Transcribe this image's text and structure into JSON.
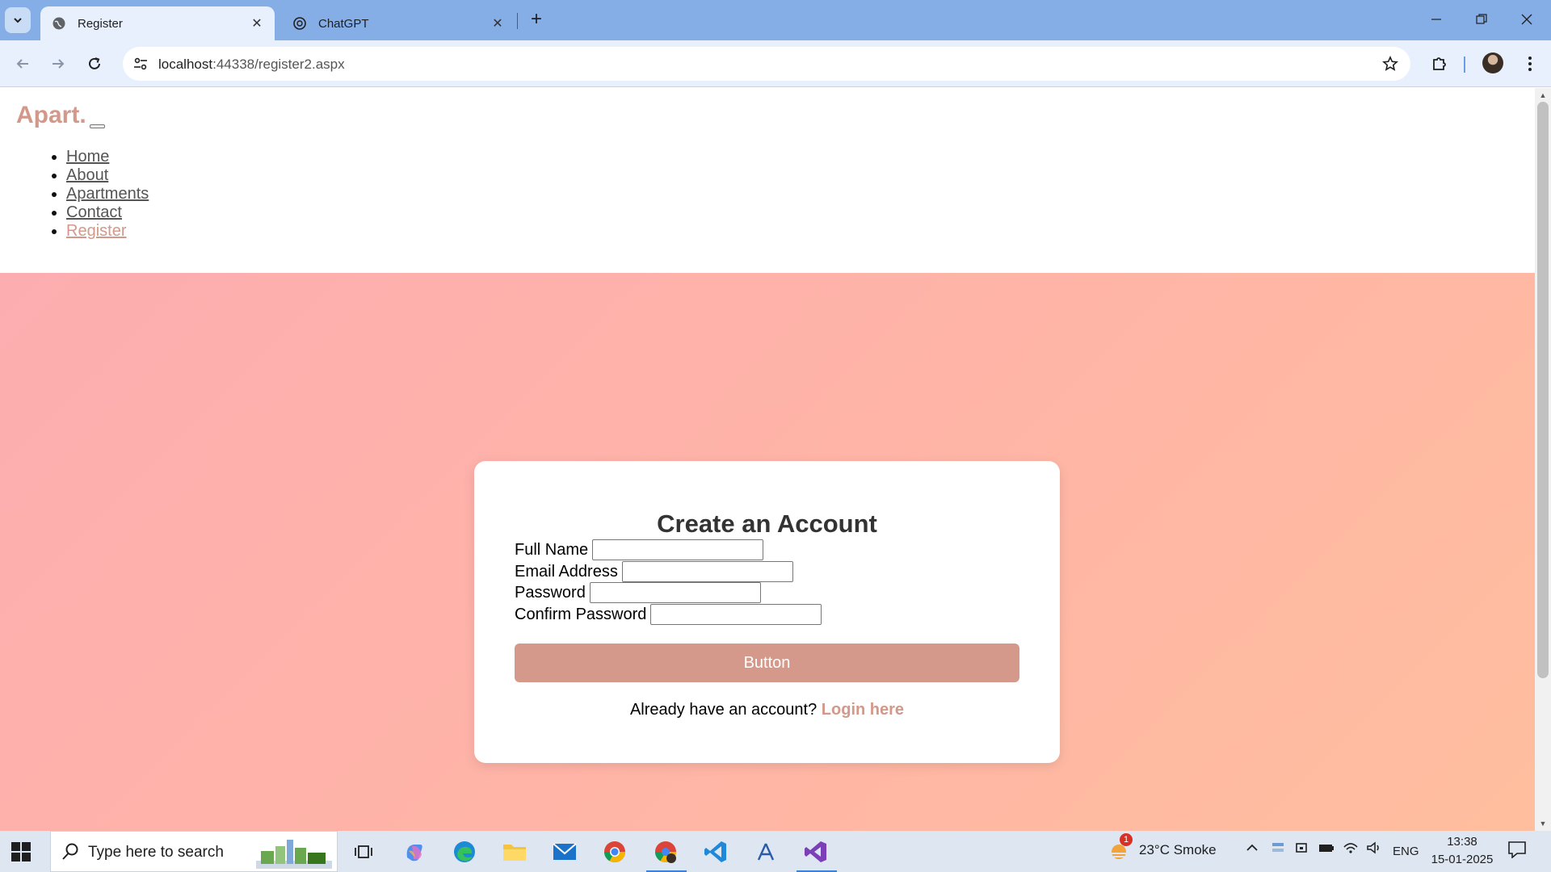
{
  "browser": {
    "tabs": [
      {
        "title": "Register",
        "active": true
      },
      {
        "title": "ChatGPT",
        "active": false
      }
    ],
    "url_host": "localhost",
    "url_path": ":44338/register2.aspx"
  },
  "site": {
    "logo": "Apart.",
    "nav": [
      {
        "label": "Home"
      },
      {
        "label": "About"
      },
      {
        "label": "Apartments"
      },
      {
        "label": "Contact"
      },
      {
        "label": "Register",
        "current": true
      }
    ]
  },
  "register_form": {
    "heading": "Create an Account",
    "fields": [
      {
        "label": "Full Name",
        "value": ""
      },
      {
        "label": "Email Address",
        "value": ""
      },
      {
        "label": "Password",
        "value": ""
      },
      {
        "label": "Confirm Password",
        "value": ""
      }
    ],
    "submit_label": "Button",
    "login_prompt": "Already have an account?",
    "login_link": "Login here"
  },
  "taskbar": {
    "search_placeholder": "Type here to search",
    "weather": "23°C  Smoke",
    "weather_badge": "1",
    "language": "ENG",
    "time": "13:38",
    "date": "15-01-2025"
  },
  "colors": {
    "accent": "#d4988a",
    "gradient_start": "#fcadb0",
    "gradient_end": "#ffbe9e",
    "tabstrip": "#85ade6"
  }
}
